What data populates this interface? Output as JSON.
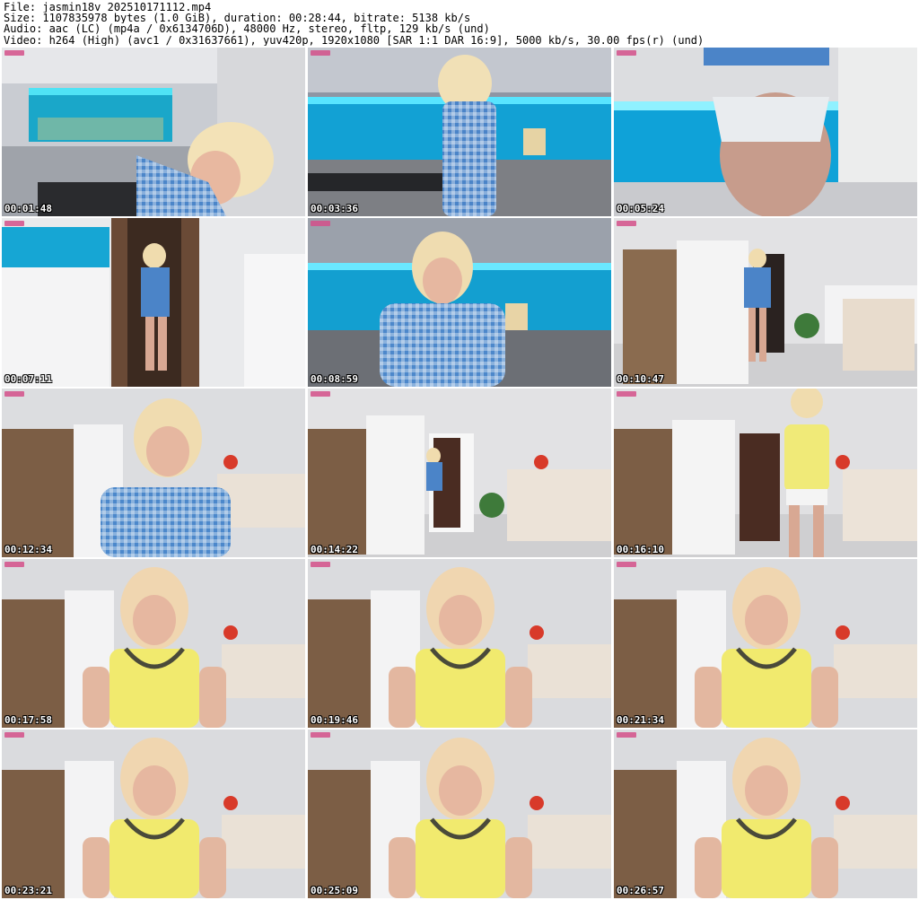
{
  "header": {
    "file": "File: jasmin18v_202510171112.mp4",
    "size": "Size: 1107835978 bytes (1.0 GiB), duration: 00:28:44, bitrate: 5138 kb/s",
    "audio": "Audio: aac (LC) (mp4a / 0x6134706D), 48000 Hz, stereo, fltp, 129 kb/s (und)",
    "video": "Video: h264 (High) (avc1 / 0x31637661), yuv420p, 1920x1080 [SAR 1:1 DAR 16:9], 5000 kb/s, 30.00 fps(r) (und)"
  },
  "thumbnails": [
    {
      "timestamp": "00:01:48",
      "scene": "kitchen-closeup"
    },
    {
      "timestamp": "00:03:36",
      "scene": "kitchen-standing"
    },
    {
      "timestamp": "00:05:24",
      "scene": "kitchen-bright"
    },
    {
      "timestamp": "00:07:11",
      "scene": "kitchen-doorway"
    },
    {
      "timestamp": "00:08:59",
      "scene": "kitchen-portrait"
    },
    {
      "timestamp": "00:10:47",
      "scene": "room-far"
    },
    {
      "timestamp": "00:12:34",
      "scene": "room-blue-portrait"
    },
    {
      "timestamp": "00:14:22",
      "scene": "room-far-door"
    },
    {
      "timestamp": "00:16:10",
      "scene": "room-yellow-standing"
    },
    {
      "timestamp": "00:17:58",
      "scene": "room-yellow-portrait"
    },
    {
      "timestamp": "00:19:46",
      "scene": "room-yellow-portrait"
    },
    {
      "timestamp": "00:21:34",
      "scene": "room-yellow-portrait"
    },
    {
      "timestamp": "00:23:21",
      "scene": "room-yellow-portrait"
    },
    {
      "timestamp": "00:25:09",
      "scene": "room-yellow-portrait"
    },
    {
      "timestamp": "00:26:57",
      "scene": "room-yellow-portrait"
    }
  ]
}
